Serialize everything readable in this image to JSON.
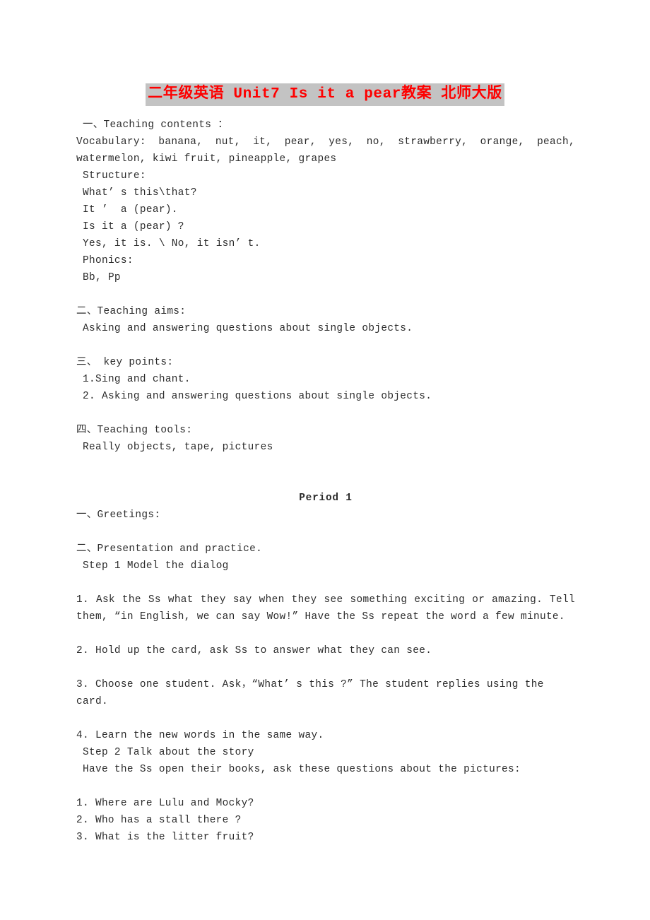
{
  "document": {
    "title": "二年级英语 Unit7 Is it a pear教案 北师大版",
    "title_color": "#fe0000",
    "title_highlight_color": "#c3c3c3",
    "body_text_color": "#2b2b2b",
    "page_background": "#ffffff"
  },
  "lines": [
    {
      "id": "l01",
      "text": " 一、Teaching contents ："
    },
    {
      "id": "l02",
      "text": " Vocabulary: banana, nut, it, pear, yes, no, strawberry, orange, peach, watermelon, kiwi fruit, pineapple, grapes"
    },
    {
      "id": "l03",
      "text": " Structure:"
    },
    {
      "id": "l04",
      "text": " What’ s this\\that?"
    },
    {
      "id": "l05",
      "text": " It ’  a (pear)."
    },
    {
      "id": "l06",
      "text": " Is it a (pear) ?"
    },
    {
      "id": "l07",
      "text": " Yes, it is. \\ No, it isn’ t."
    },
    {
      "id": "l08",
      "text": " Phonics:"
    },
    {
      "id": "l09",
      "text": " Bb, Pp"
    },
    {
      "id": "l10",
      "text": ""
    },
    {
      "id": "l11",
      "text": "二、Teaching aims:"
    },
    {
      "id": "l12",
      "text": " Asking and answering questions about single objects."
    },
    {
      "id": "l13",
      "text": ""
    },
    {
      "id": "l14",
      "text": "三、 key points:"
    },
    {
      "id": "l15",
      "text": " 1.Sing and chant."
    },
    {
      "id": "l16",
      "text": " 2. Asking and answering questions about single objects."
    },
    {
      "id": "l17",
      "text": ""
    },
    {
      "id": "l18",
      "text": "四、Teaching tools:"
    },
    {
      "id": "l19",
      "text": " Really objects, tape, pictures"
    },
    {
      "id": "l20",
      "text": ""
    },
    {
      "id": "l21",
      "text": ""
    },
    {
      "id": "l22",
      "text": "Period 1"
    },
    {
      "id": "l23",
      "text": "一、Greetings:"
    },
    {
      "id": "l24",
      "text": ""
    },
    {
      "id": "l25",
      "text": "二、Presentation and practice."
    },
    {
      "id": "l26",
      "text": " Step 1 Model the dialog"
    },
    {
      "id": "l27",
      "text": ""
    },
    {
      "id": "l28",
      "text": "1. Ask the Ss what they say when they see something exciting or amazing. Tell them, “in English, we can say Wow!”  Have the Ss repeat the word a few minute."
    },
    {
      "id": "l29",
      "text": ""
    },
    {
      "id": "l30",
      "text": "2. Hold up the card, ask Ss to answer what they can see."
    },
    {
      "id": "l31",
      "text": ""
    },
    {
      "id": "l32",
      "text": "3. Choose one student. Ask，“What’ s this ?” The student replies using the card."
    },
    {
      "id": "l33",
      "text": ""
    },
    {
      "id": "l34",
      "text": "4. Learn the new words in the same way."
    },
    {
      "id": "l35",
      "text": " Step 2 Talk about the story"
    },
    {
      "id": "l36",
      "text": " Have the Ss open their books, ask these questions about the pictures:"
    },
    {
      "id": "l37",
      "text": ""
    },
    {
      "id": "l38",
      "text": "1. Where are Lulu and Mocky?"
    },
    {
      "id": "l39",
      "text": "2. Who has a stall there ?"
    },
    {
      "id": "l40",
      "text": "3. What is the litter fruit?"
    }
  ]
}
